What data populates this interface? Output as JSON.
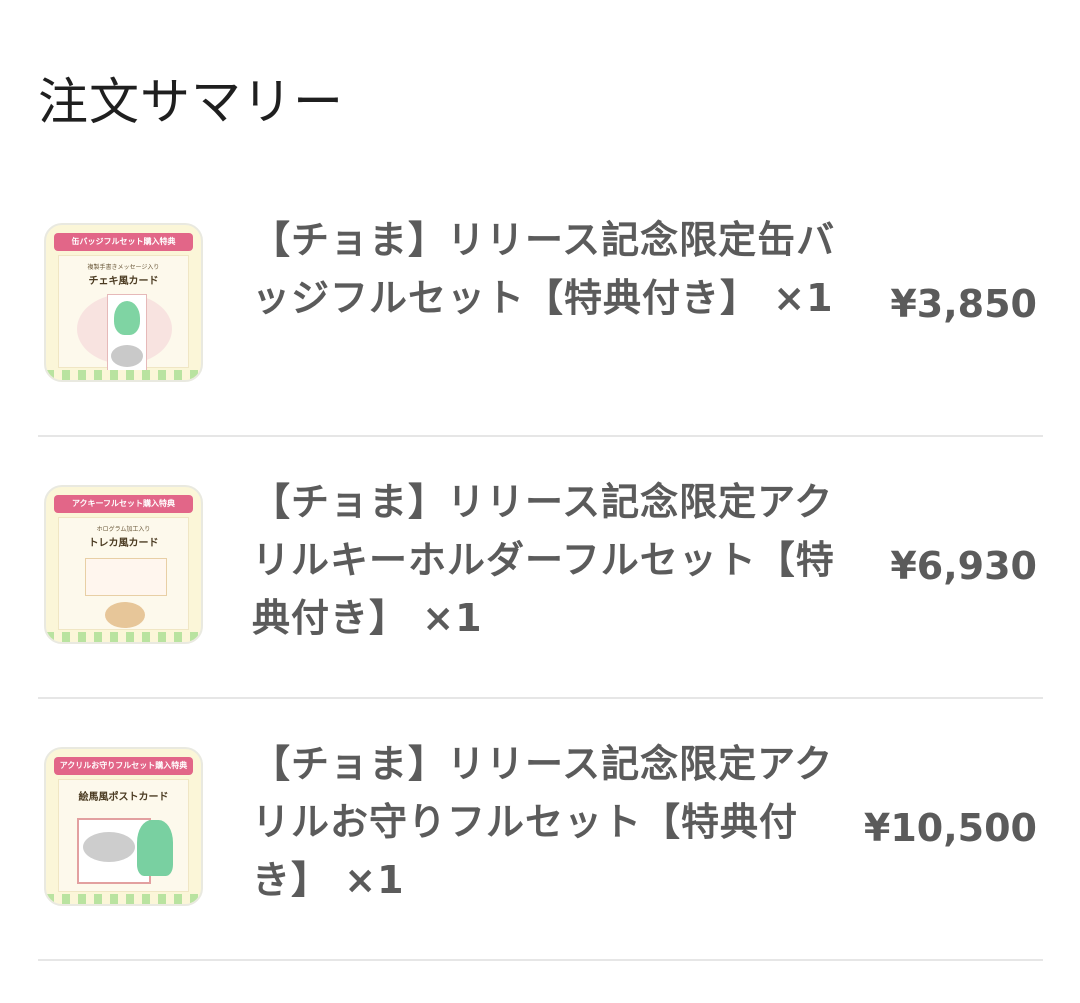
{
  "summary": {
    "title": "注文サマリー"
  },
  "items": [
    {
      "name": "【チョま】リリース記念限定缶バッジフルセット【特典付き】",
      "quantity": "×1",
      "price": "¥3,850",
      "thumb_banner": "缶バッジフルセット購入特典",
      "thumb_sub": "複製手書きメッセージ入り",
      "thumb_heading": "チェキ風カード"
    },
    {
      "name": "【チョま】リリース記念限定アクリルキーホルダーフルセット【特典付き】",
      "quantity": "×1",
      "price": "¥6,930",
      "thumb_banner": "アクキーフルセット購入特典",
      "thumb_sub": "ホログラム加工入り",
      "thumb_heading": "トレカ風カード"
    },
    {
      "name": "【チョま】リリース記念限定アクリルお守りフルセット【特典付き】",
      "quantity": "×1",
      "price": "¥10,500",
      "thumb_banner": "アクリルお守りフルセット購入特典",
      "thumb_sub": "",
      "thumb_heading": "絵馬風ポストカード"
    }
  ],
  "colors": {
    "text_main": "#5b5b5b",
    "title": "#1f1f1f",
    "divider": "#e6e6e6",
    "thumb_banner": "#e26688",
    "thumb_bg": "#fbf6d8"
  }
}
